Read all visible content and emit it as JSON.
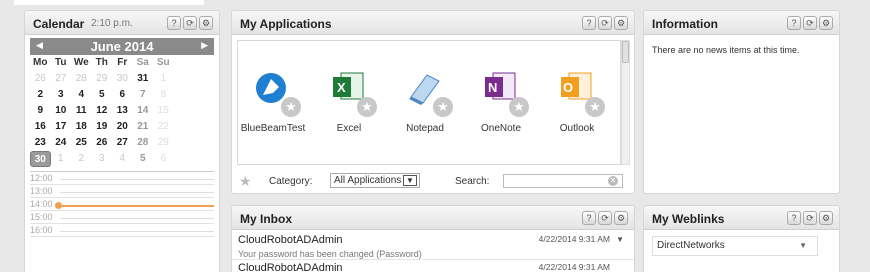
{
  "calendar": {
    "title": "Calendar",
    "time": "2:10 p.m.",
    "month": "June 2014",
    "prev": "◀",
    "next": "▶",
    "weekdays": [
      "Mo",
      "Tu",
      "We",
      "Th",
      "Fr",
      "Sa",
      "Su"
    ],
    "weeks": [
      [
        "26",
        "27",
        "28",
        "29",
        "30",
        "31",
        "1"
      ],
      [
        "2",
        "3",
        "4",
        "5",
        "6",
        "7",
        "8"
      ],
      [
        "9",
        "10",
        "11",
        "12",
        "13",
        "14",
        "15"
      ],
      [
        "16",
        "17",
        "18",
        "19",
        "20",
        "21",
        "22"
      ],
      [
        "23",
        "24",
        "25",
        "26",
        "27",
        "28",
        "29"
      ],
      [
        "30",
        "1",
        "2",
        "3",
        "4",
        "5",
        "6"
      ]
    ],
    "hours": [
      "12:00",
      "13:00",
      "14:00",
      "15:00",
      "16:00"
    ]
  },
  "apps": {
    "title": "My Applications",
    "items": [
      {
        "label": "BlueBeamTest",
        "icon": "bluebeam-icon",
        "color": "#1f7fd0"
      },
      {
        "label": "Excel",
        "icon": "excel-icon",
        "color": "#1e7b3a"
      },
      {
        "label": "Notepad",
        "icon": "notepad-icon",
        "color": "#6fa8dc"
      },
      {
        "label": "OneNote",
        "icon": "onenote-icon",
        "color": "#7b2c8f"
      },
      {
        "label": "Outlook",
        "icon": "outlook-icon",
        "color": "#f0a020"
      }
    ],
    "category_label": "Category:",
    "category_value": "All Applications",
    "search_label": "Search:",
    "search_value": ""
  },
  "info": {
    "title": "Information",
    "message": "There are no news items at this time."
  },
  "inbox": {
    "title": "My Inbox",
    "messages": [
      {
        "from": "CloudRobotADAdmin",
        "date": "4/22/2014 9:31 AM",
        "subject": "Your password has been changed (Password)"
      },
      {
        "from": "CloudRobotADAdmin",
        "date": "4/22/2014 9:31 AM",
        "subject": ""
      }
    ]
  },
  "weblinks": {
    "title": "My Weblinks",
    "selected": "DirectNetworks"
  },
  "controls": {
    "help": "?",
    "refresh": "⟳",
    "settings": "⚙"
  }
}
